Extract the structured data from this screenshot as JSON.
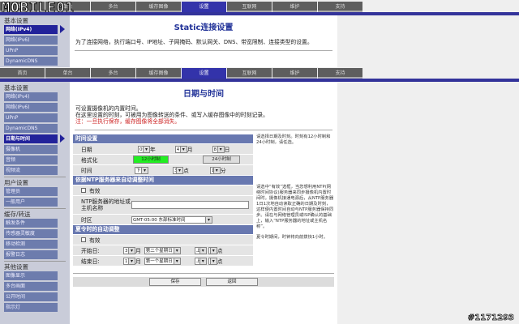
{
  "tabs": [
    "首页",
    "单台",
    "多台",
    "缓存图像",
    "设置",
    "互联网",
    "维护",
    "支持"
  ],
  "logo": "MOBILE01",
  "top_frame": {
    "sidebar_header": "基本设置",
    "sidebar_items": [
      "网络(IPv4)",
      "网络(IPv6)",
      "UPnP",
      "DynamicDNS"
    ],
    "title": "Static连接设置",
    "description": "为了连接网络，执行端口号、IP地址、子网掩码、默认网关、DNS、带宽限制、连接类型的设置。"
  },
  "sidebar": {
    "sections": [
      {
        "header": "基本设置",
        "items": [
          "网络(IPv4)",
          "网络(IPv6)",
          "UPnP",
          "DynamicDNS",
          "日期与时间",
          "摄像机",
          "音频",
          "视频流"
        ]
      },
      {
        "header": "用户设置",
        "items": [
          "管理员",
          "一般用户"
        ]
      },
      {
        "header": "缓存/转送",
        "items": [
          "触发条件",
          "传感器灵敏度",
          "移动检测",
          "报警日志"
        ]
      },
      {
        "header": "其他设置",
        "items": [
          "图像显示",
          "多台画面",
          "公开时间",
          "指示灯"
        ]
      }
    ],
    "selected": "日期与时间"
  },
  "main": {
    "title": "日期与时间",
    "desc1": "可设置摄像机的内置时间。",
    "desc2": "在这里设置的时刻，可被用为图像转送的条件、或写入缓存图像中的时刻记录。",
    "note": "注：一旦执行保存，缓存图像将全部消失。",
    "time_section": {
      "header": "时间设置",
      "date_label": "日期",
      "year": "09",
      "year_unit": "年",
      "month": "4",
      "month_unit": "月",
      "day": "8",
      "day_unit": "日",
      "format_label": "格式化",
      "btn_12h": "12小时制",
      "btn_24h": "24小时制",
      "time_label": "时间",
      "ampm": "下午",
      "hour": "3",
      "hour_unit": "点",
      "minute": "17",
      "minute_unit": "分",
      "active_color": "#22ee22"
    },
    "ntp_section": {
      "header": "依据NTP服务器来自动调整时间",
      "enable": "有效",
      "server_label": "NTP服务器的地址或主机名称",
      "server_value": "",
      "tz_label": "时区",
      "tz_value": "GMT-05:00 东部标准时间"
    },
    "dst_section": {
      "header": "夏令时的自动调整",
      "enable": "有效",
      "start_label": "开始日:",
      "start_month": "3",
      "start_week": "第二个星期日",
      "start_ampm": "上午",
      "start_hour": "2",
      "end_label": "结束日:",
      "end_month": "11",
      "end_week": "第一个星期日",
      "end_ampm": "上午",
      "end_hour": "2",
      "month_unit": "月",
      "hour_unit": "点"
    },
    "save": "保存",
    "back": "返回"
  },
  "help": {
    "time": "请选择日期及时刻。时刻有12小时制和24小时制，请任选。",
    "ntp": "请选中“有效”选框，当您想利用NTP(网络时间协议)服务器来同步摄像机内置时间时。摄像机接通电源后，从NTP服务器1日1次地自动读取正确的日期及时刻，这样便内置时间自动与NTP服务器保持同步。请在与网络管理员或ISP确认的基础上，输入“NTP服务器的地址或主机名称”。",
    "dst": "夏令时期间，时钟将向前拨快1小时。"
  },
  "watermark": "#1171293"
}
